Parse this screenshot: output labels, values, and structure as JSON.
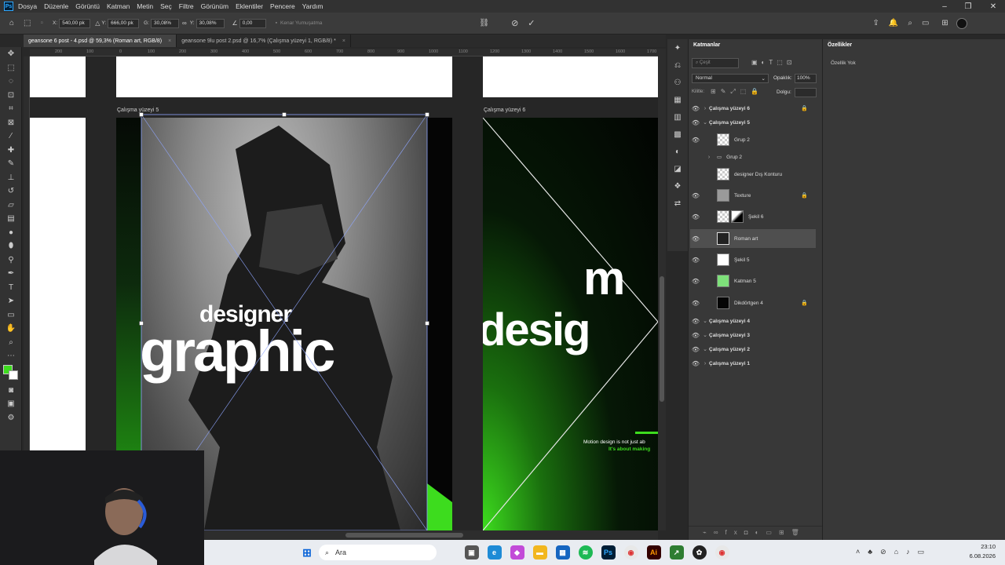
{
  "menubar": {
    "app_logo": "Ps",
    "items": [
      "Dosya",
      "Düzenle",
      "Görüntü",
      "Katman",
      "Metin",
      "Seç",
      "Filtre",
      "Görünüm",
      "Eklentiler",
      "Pencere",
      "Yardım"
    ]
  },
  "options_bar": {
    "x_label": "X:",
    "x_value": "540,00 pk",
    "y_label": "Y:",
    "y_value": "666,00 pk",
    "w_label": "G:",
    "w_value": "30,08%",
    "h_label": "Y:",
    "h_value": "30,08%",
    "angle_value": "0,00",
    "smoothing_label": "Kenar Yumuşatma"
  },
  "tabs": [
    {
      "label": "geansone 6 post - 4.psd @ 59,3% (Roman art, RGB/8)",
      "close": "×"
    },
    {
      "label": "geansone 9lu post 2.psd @ 16,7% (Çalışma yüzeyi 1, RGB/8) *",
      "close": "×"
    }
  ],
  "ruler_ticks": [
    "200",
    "100",
    "0",
    "100",
    "200",
    "300",
    "400",
    "500",
    "600",
    "700",
    "800",
    "900",
    "1000",
    "1100",
    "1200",
    "1300",
    "1400",
    "1500",
    "1600",
    "1700"
  ],
  "artboards": {
    "left_label": "Çalışma yüzeyi 5",
    "right_label": "Çalışma yüzeyi 6",
    "poster_small": "designer",
    "poster_big": "graphic",
    "right_big1": "m",
    "right_big2": "desig",
    "right_tagline1": "Motion design is not just ab",
    "right_tagline2": "It's about making"
  },
  "layers_panel": {
    "tab_label": "Katmanlar",
    "search_placeholder": "Çeşit",
    "blend_mode": "Normal",
    "opacity_label": "Opaklık:",
    "opacity_value": "100%",
    "lock_label": "Kilitle:",
    "fill_label": "Dolgu:",
    "layers": [
      {
        "name": "Çalışma yüzeyi 6",
        "group": true,
        "open": false,
        "locked": true,
        "visible": true
      },
      {
        "name": "Çalışma yüzeyi 5",
        "group": true,
        "open": true,
        "locked": false,
        "visible": true
      },
      {
        "name": "Grup 2",
        "thumb": "checker",
        "visible": true
      },
      {
        "name": "Grup 2",
        "thumb": "folder",
        "visible": false
      },
      {
        "name": "designer Dış Konturu",
        "thumb": "checker",
        "visible": false
      },
      {
        "name": "Texture",
        "thumb": "gray",
        "locked": true,
        "visible": true
      },
      {
        "name": "Şekil 6",
        "thumb": "mask",
        "visible": true
      },
      {
        "name": "Roman art",
        "thumb": "dark",
        "selected": true,
        "visible": true
      },
      {
        "name": "Şekil 5",
        "thumb": "white",
        "visible": true
      },
      {
        "name": "Katman 5",
        "thumb": "green",
        "visible": true
      },
      {
        "name": "Dikdörtgen 4",
        "thumb": "black",
        "locked": true,
        "visible": true
      },
      {
        "name": "Çalışma yüzeyi 4",
        "group": true,
        "visible": true
      },
      {
        "name": "Çalışma yüzeyi 3",
        "group": true,
        "visible": true
      },
      {
        "name": "Çalışma yüzeyi 2",
        "group": true,
        "visible": true
      },
      {
        "name": "Çalışma yüzeyi 1",
        "group": true,
        "visible": true
      }
    ]
  },
  "properties_panel": {
    "tab_label": "Özellikler",
    "empty_text": "Özellik Yok"
  },
  "taskbar": {
    "search_placeholder": "Ara",
    "time": "23:10",
    "date": "6.08.2026"
  },
  "colors": {
    "accent_green": "#3ddc1e",
    "selected_layer": "#4f4f4f",
    "panel_bg": "#383838"
  }
}
